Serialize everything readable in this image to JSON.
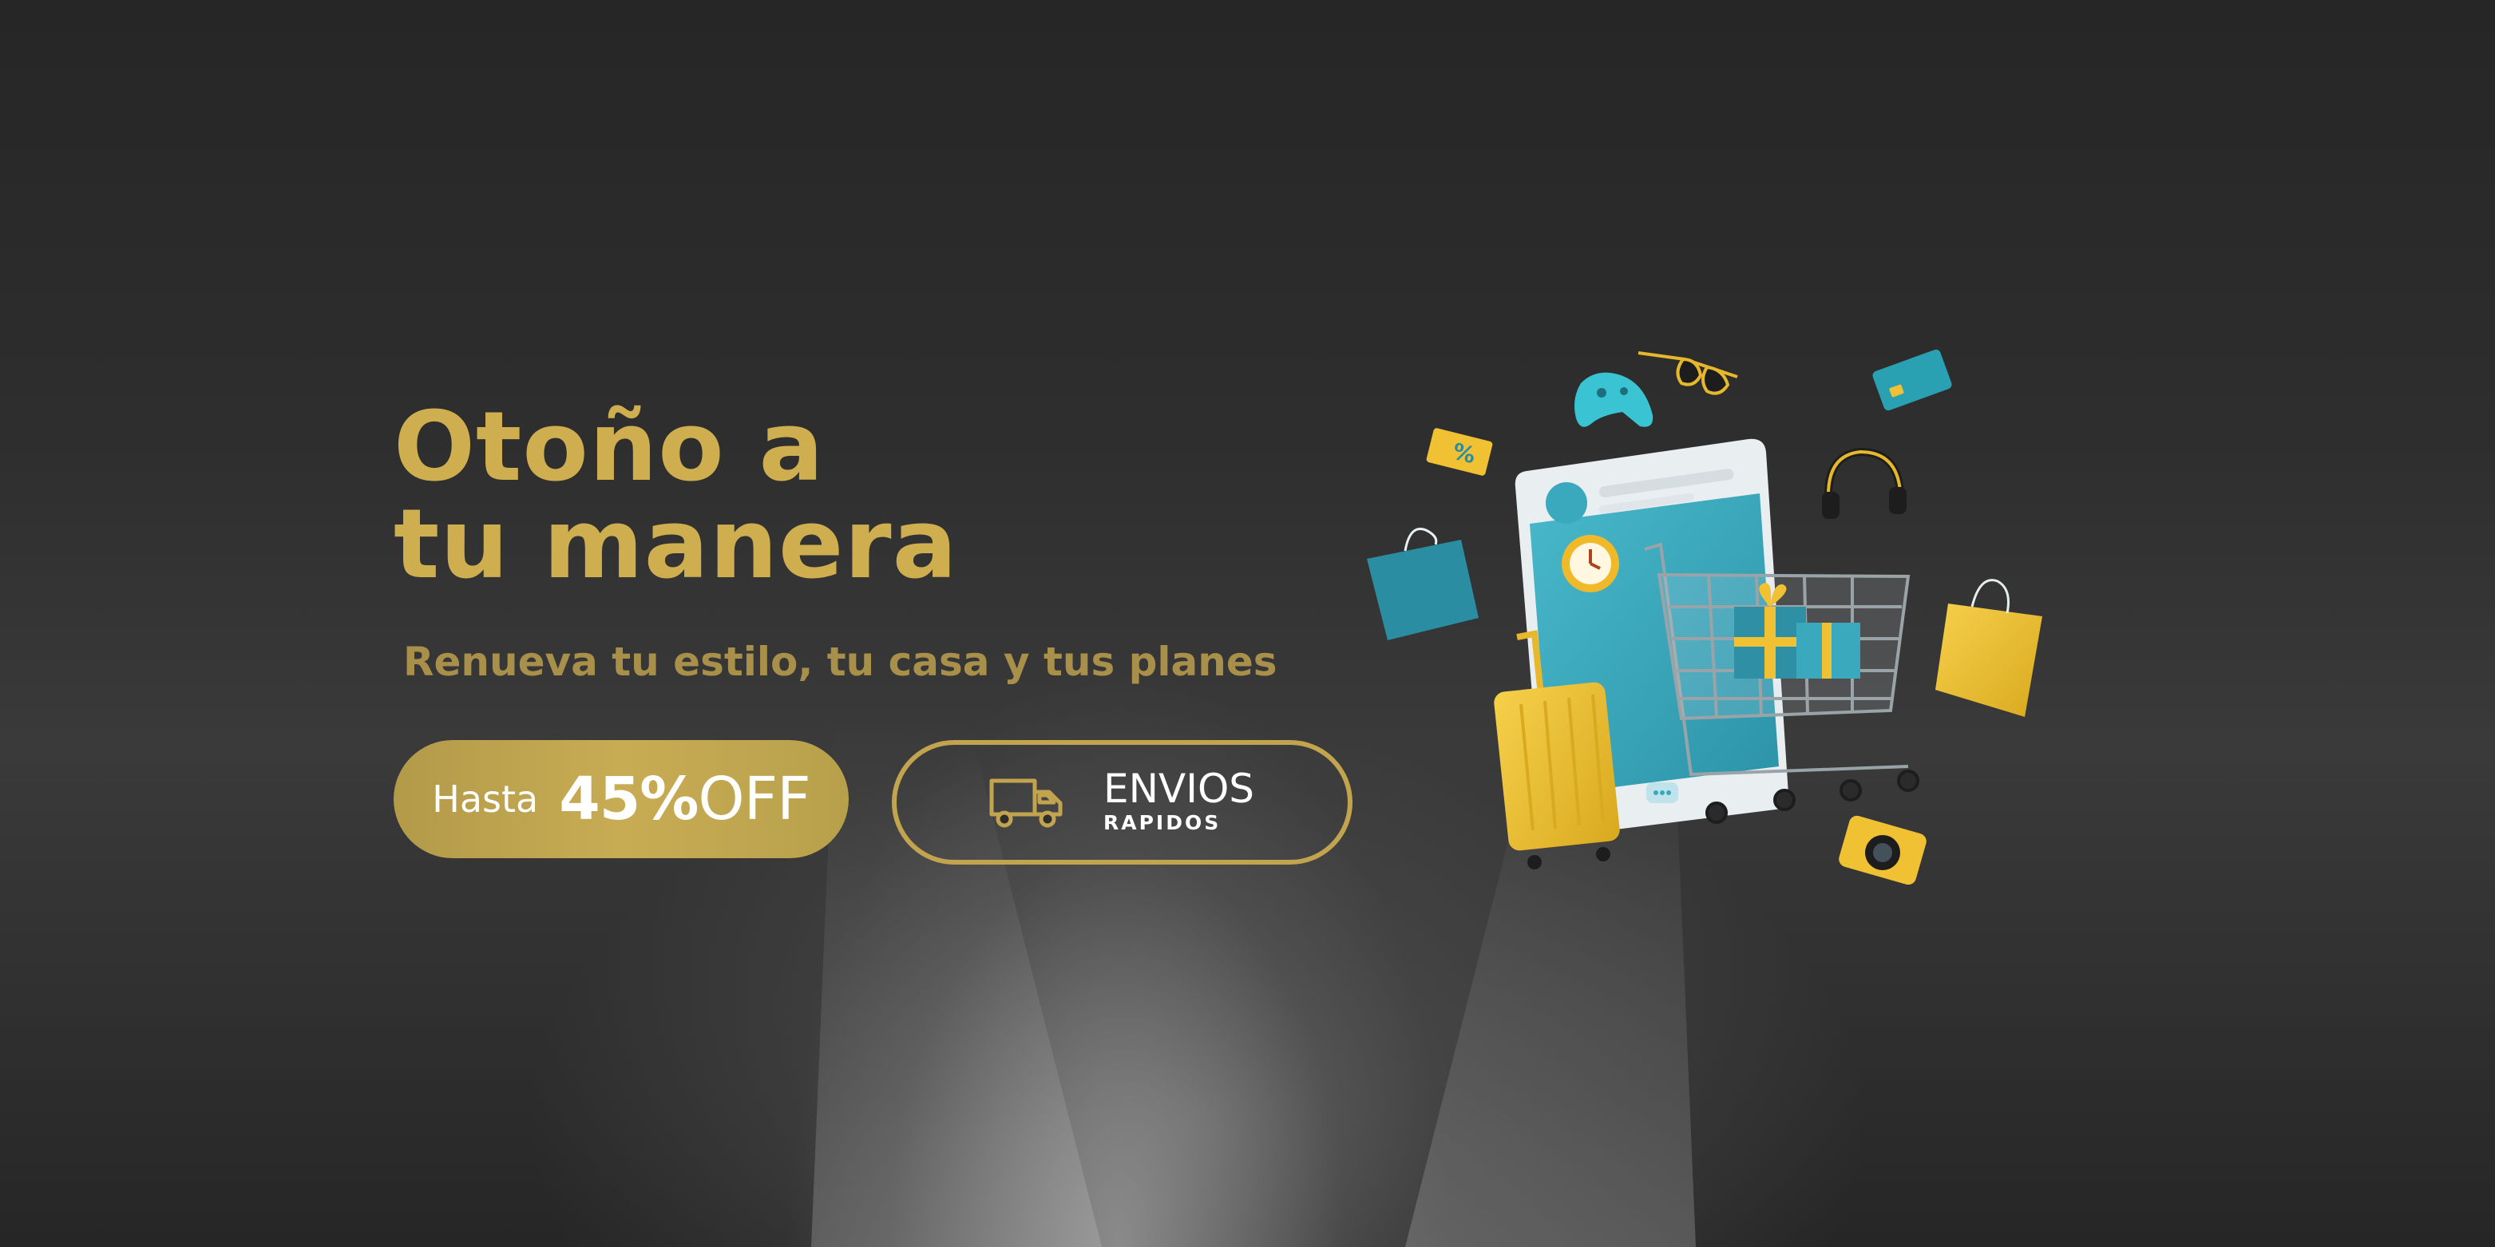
{
  "hero": {
    "title_line1": "Otoño a",
    "title_line2": "tu manera",
    "subtitle": "Renueva tu estilo, tu casa y tus planes"
  },
  "promo": {
    "prefix": "Hasta",
    "number": "45%",
    "suffix": "OFF"
  },
  "shipping": {
    "title": "ENVIOS",
    "subtitle": "RAPIDOS",
    "icon": "truck-icon"
  },
  "illustration": {
    "icons": [
      "shopping-cart-icon",
      "suitcase-icon",
      "game-controller-icon",
      "sunglasses-icon",
      "credit-card-icon",
      "headphones-icon",
      "alarm-clock-icon",
      "shopping-bag-icon",
      "discount-ticket-icon",
      "camera-icon",
      "gift-box-icon"
    ]
  },
  "colors": {
    "gold": "#cfae4f",
    "gold_muted": "#a8904a",
    "teal": "#3aa9bd",
    "yellow": "#f0c233",
    "background": "#2b2b2b"
  }
}
